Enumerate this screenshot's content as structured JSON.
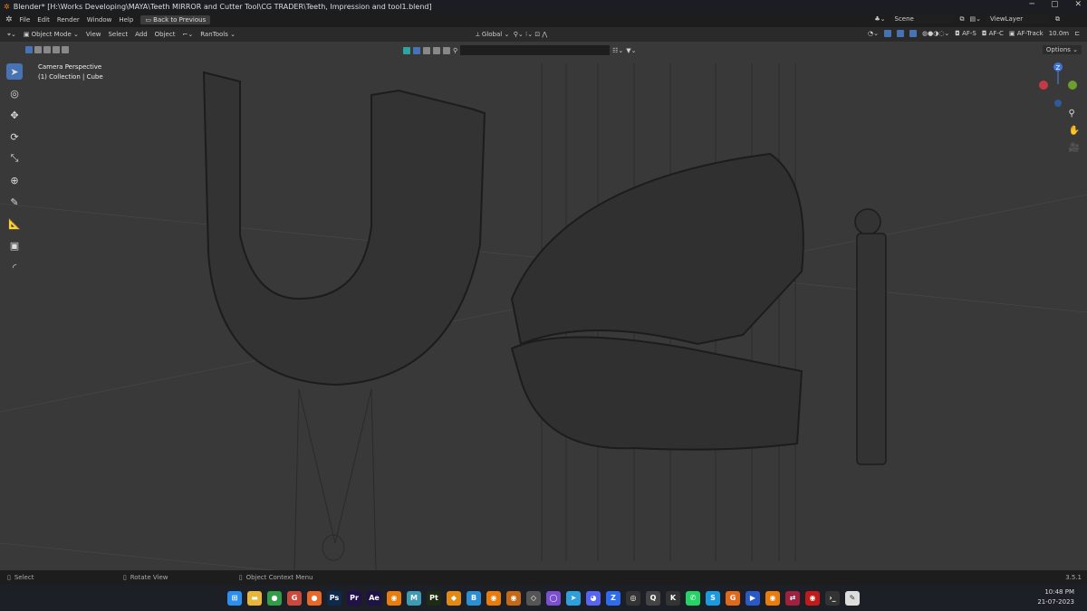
{
  "window": {
    "title": "Blender* [H:\\Works Developing\\MAYA\\Teeth MIRROR and Cutter Tool\\CG TRADER\\Teeth, Impression and tool1.blend]",
    "minimize": "─",
    "maximize": "▢",
    "close": "✕"
  },
  "menu": {
    "items": [
      "File",
      "Edit",
      "Render",
      "Window",
      "Help"
    ],
    "back": "Back to Previous",
    "scene": "Scene",
    "view_layer": "ViewLayer"
  },
  "header": {
    "mode": "Object Mode",
    "items": [
      "View",
      "Select",
      "Add",
      "Object"
    ],
    "addon": "RanTools",
    "orientation": "Global",
    "af_s": "AF-S",
    "af_c": "AF-C",
    "af_track": "AF-Track",
    "distance": "10.0m"
  },
  "toolrow": {
    "options": "Options",
    "search_placeholder": ""
  },
  "viewport": {
    "camera_label": "Camera Perspective",
    "collection_label": "(1) Collection | Cube",
    "gizmo_z": "Z"
  },
  "status": {
    "select": "Select",
    "rotate": "Rotate View",
    "context": "Object Context Menu",
    "version": "3.5.1"
  },
  "taskbar": {
    "icons": [
      {
        "name": "windows-start",
        "label": "⊞",
        "color": "#2b8ff0"
      },
      {
        "name": "file-explorer",
        "label": "▬",
        "color": "#e8b73a"
      },
      {
        "name": "chrome",
        "label": "●",
        "color": "#2f9e46"
      },
      {
        "name": "chrome-profile",
        "label": "G",
        "color": "#c94a3a"
      },
      {
        "name": "firefox",
        "label": "●",
        "color": "#e8682a"
      },
      {
        "name": "photoshop",
        "label": "Ps",
        "color": "#0d2a4d"
      },
      {
        "name": "premiere",
        "label": "Pr",
        "color": "#22104a"
      },
      {
        "name": "after-effects",
        "label": "Ae",
        "color": "#1f1247"
      },
      {
        "name": "blender",
        "label": "◉",
        "color": "#e87d0d"
      },
      {
        "name": "maya",
        "label": "M",
        "color": "#3e9bb5"
      },
      {
        "name": "painter",
        "label": "Pt",
        "color": "#1d2b12"
      },
      {
        "name": "app-orange",
        "label": "◆",
        "color": "#e28a16"
      },
      {
        "name": "app-blue",
        "label": "B",
        "color": "#2b8fd6"
      },
      {
        "name": "blender-2",
        "label": "◉",
        "color": "#e87d0d"
      },
      {
        "name": "blender-3",
        "label": "◉",
        "color": "#c46a17"
      },
      {
        "name": "unity-hub",
        "label": "◇",
        "color": "#555"
      },
      {
        "name": "github",
        "label": "◯",
        "color": "#7b4fd0"
      },
      {
        "name": "telegram",
        "label": "➤",
        "color": "#2ea0dc"
      },
      {
        "name": "discord",
        "label": "◕",
        "color": "#5865f2"
      },
      {
        "name": "zoom",
        "label": "Z",
        "color": "#2d6cf0"
      },
      {
        "name": "obs",
        "label": "◎",
        "color": "#333"
      },
      {
        "name": "app-search",
        "label": "Q",
        "color": "#444"
      },
      {
        "name": "app-k",
        "label": "K",
        "color": "#333"
      },
      {
        "name": "whatsapp",
        "label": "✆",
        "color": "#25d366"
      },
      {
        "name": "skype",
        "label": "S",
        "color": "#1a9be0"
      },
      {
        "name": "app-g",
        "label": "G",
        "color": "#e06a1a"
      },
      {
        "name": "app-play",
        "label": "▶",
        "color": "#2a5ac8"
      },
      {
        "name": "blender-4",
        "label": "◉",
        "color": "#e87d0d"
      },
      {
        "name": "app-arrows",
        "label": "⇄",
        "color": "#a02040"
      },
      {
        "name": "app-red",
        "label": "◉",
        "color": "#c01a1a"
      },
      {
        "name": "terminal",
        "label": "›_",
        "color": "#333"
      },
      {
        "name": "notepad",
        "label": "✎",
        "color": "#ddd"
      }
    ]
  },
  "clock": {
    "time": "10:48 PM",
    "date": "21-07-2023"
  },
  "colors": {
    "accent": "#4772b3",
    "viewport": "#393939",
    "wire": "#1a1a1a"
  }
}
